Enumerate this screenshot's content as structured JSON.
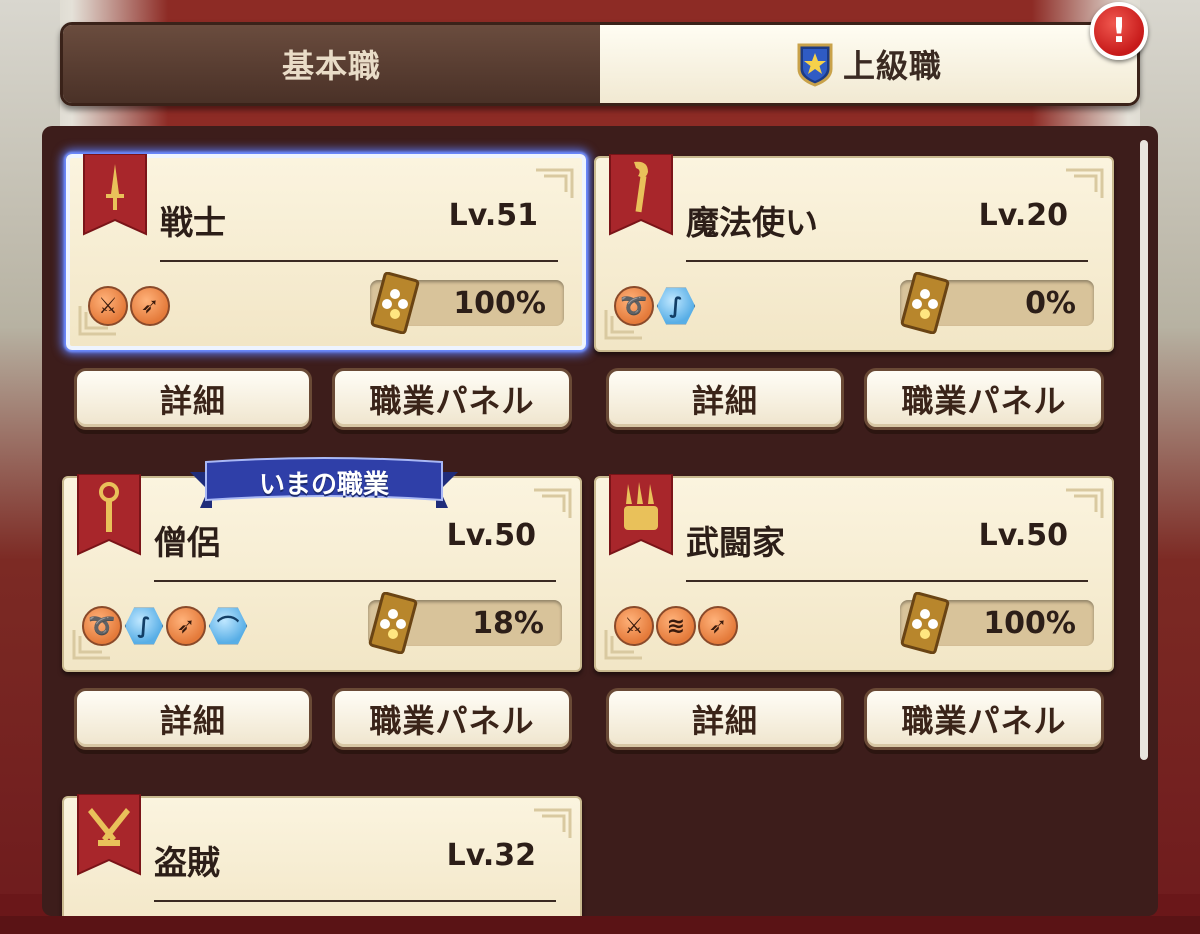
{
  "tabs": [
    {
      "label": "基本職",
      "active": false
    },
    {
      "label": "上級職",
      "active": true
    }
  ],
  "alert_badge": "!",
  "current_job_label": "いまの職業",
  "buttons": {
    "detail": "詳細",
    "job_panel": "職業パネル"
  },
  "jobs": [
    {
      "name": "戦士",
      "level": "Lv.51",
      "percent": "100%",
      "icon": "sword-icon",
      "selected": true,
      "weapons": [
        {
          "icon": "sword-weapon-icon",
          "glyph": "⚔",
          "color": "orange"
        },
        {
          "icon": "spear-weapon-icon",
          "glyph": "➶",
          "color": "orange"
        }
      ]
    },
    {
      "name": "魔法使い",
      "level": "Lv.20",
      "percent": "0%",
      "icon": "staff-icon",
      "selected": false,
      "weapons": [
        {
          "icon": "whip-weapon-icon",
          "glyph": "➰",
          "color": "orange"
        },
        {
          "icon": "staff-weapon-icon",
          "glyph": "∫",
          "color": "blue"
        }
      ]
    },
    {
      "name": "僧侶",
      "level": "Lv.50",
      "percent": "18%",
      "icon": "mace-icon",
      "selected": false,
      "current": true,
      "weapons": [
        {
          "icon": "whip-weapon-icon",
          "glyph": "➰",
          "color": "orange"
        },
        {
          "icon": "staff-weapon-icon",
          "glyph": "∫",
          "color": "blue"
        },
        {
          "icon": "spear-weapon-icon",
          "glyph": "➶",
          "color": "orange"
        },
        {
          "icon": "boomerang-weapon-icon",
          "glyph": "⌒",
          "color": "blue"
        }
      ]
    },
    {
      "name": "武闘家",
      "level": "Lv.50",
      "percent": "100%",
      "icon": "claw-icon",
      "selected": false,
      "weapons": [
        {
          "icon": "sword-weapon-icon",
          "glyph": "⚔",
          "color": "orange"
        },
        {
          "icon": "claw-weapon-icon",
          "glyph": "≋",
          "color": "orange"
        },
        {
          "icon": "spear-weapon-icon",
          "glyph": "➶",
          "color": "orange"
        }
      ]
    },
    {
      "name": "盗賊",
      "level": "Lv.32",
      "percent": "",
      "icon": "daggers-icon",
      "selected": false,
      "weapons": []
    }
  ],
  "colors": {
    "selected_glow": "#5b7dff",
    "banner_red": "#a8262b",
    "ribbon_blue": "#2f3fa8"
  }
}
